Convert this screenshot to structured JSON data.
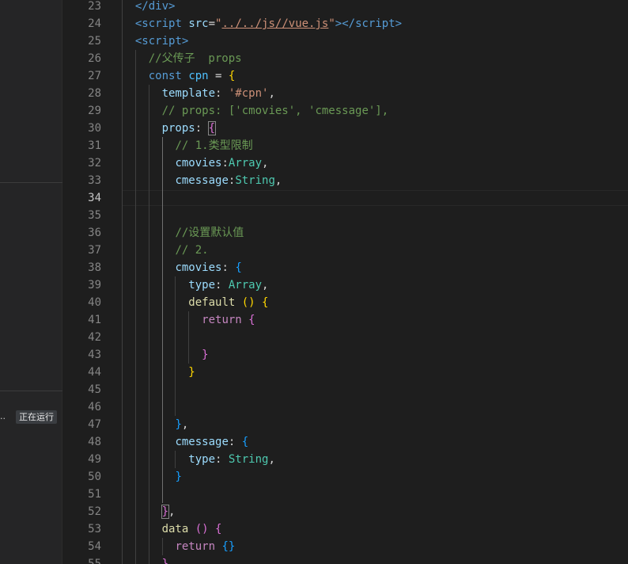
{
  "sidebar": {
    "ellipsis": "..",
    "status_badge": "正在运行"
  },
  "editor": {
    "active_line": 34,
    "lines": [
      {
        "n": 23,
        "tokens": [
          {
            "t": "</",
            "c": "tk-tag"
          },
          {
            "t": "div",
            "c": "tk-tag"
          },
          {
            "t": ">",
            "c": "tk-tag"
          }
        ],
        "indent": 1
      },
      {
        "n": 24,
        "tokens": [
          {
            "t": "<",
            "c": "tk-tag"
          },
          {
            "t": "script",
            "c": "tk-tag"
          },
          {
            "t": " ",
            "c": "tk-punc"
          },
          {
            "t": "src",
            "c": "tk-attr"
          },
          {
            "t": "=",
            "c": "tk-punc"
          },
          {
            "t": "\"",
            "c": "tk-str"
          },
          {
            "t": "../../js//vue.js",
            "c": "tk-str-u"
          },
          {
            "t": "\"",
            "c": "tk-str"
          },
          {
            "t": "></",
            "c": "tk-tag"
          },
          {
            "t": "script",
            "c": "tk-tag"
          },
          {
            "t": ">",
            "c": "tk-tag"
          }
        ],
        "indent": 1
      },
      {
        "n": 25,
        "tokens": [
          {
            "t": "<",
            "c": "tk-tag"
          },
          {
            "t": "script",
            "c": "tk-tag"
          },
          {
            "t": ">",
            "c": "tk-tag"
          }
        ],
        "indent": 1
      },
      {
        "n": 26,
        "tokens": [
          {
            "t": "//父传子  props",
            "c": "tk-cmt"
          }
        ],
        "indent": 2
      },
      {
        "n": 27,
        "tokens": [
          {
            "t": "const",
            "c": "tk-kw"
          },
          {
            "t": " ",
            "c": "tk-punc"
          },
          {
            "t": "cpn",
            "c": "tk-var"
          },
          {
            "t": " = ",
            "c": "tk-punc"
          },
          {
            "t": "{",
            "c": "br-gold"
          }
        ],
        "indent": 2
      },
      {
        "n": 28,
        "tokens": [
          {
            "t": "template",
            "c": "tk-prop"
          },
          {
            "t": ": ",
            "c": "tk-punc"
          },
          {
            "t": "'#cpn'",
            "c": "tk-str"
          },
          {
            "t": ",",
            "c": "tk-punc"
          }
        ],
        "indent": 3
      },
      {
        "n": 29,
        "tokens": [
          {
            "t": "// props: ['cmovies', 'cmessage'],",
            "c": "tk-cmt"
          }
        ],
        "indent": 3
      },
      {
        "n": 30,
        "tokens": [
          {
            "t": "props",
            "c": "tk-prop"
          },
          {
            "t": ": ",
            "c": "tk-punc"
          },
          {
            "t": "{",
            "c": "br-pink br-match"
          }
        ],
        "indent": 3
      },
      {
        "n": 31,
        "tokens": [
          {
            "t": "// 1.类型限制",
            "c": "tk-cmt"
          }
        ],
        "indent": 4
      },
      {
        "n": 32,
        "tokens": [
          {
            "t": "cmovies",
            "c": "tk-prop"
          },
          {
            "t": ":",
            "c": "tk-punc"
          },
          {
            "t": "Array",
            "c": "tk-type"
          },
          {
            "t": ",",
            "c": "tk-punc"
          }
        ],
        "indent": 4
      },
      {
        "n": 33,
        "tokens": [
          {
            "t": "cmessage",
            "c": "tk-prop"
          },
          {
            "t": ":",
            "c": "tk-punc"
          },
          {
            "t": "String",
            "c": "tk-type"
          },
          {
            "t": ",",
            "c": "tk-punc"
          }
        ],
        "indent": 4
      },
      {
        "n": 34,
        "tokens": [],
        "indent": 0
      },
      {
        "n": 35,
        "tokens": [],
        "indent": 0
      },
      {
        "n": 36,
        "tokens": [
          {
            "t": "//设置默认值",
            "c": "tk-cmt"
          }
        ],
        "indent": 4
      },
      {
        "n": 37,
        "tokens": [
          {
            "t": "// 2.",
            "c": "tk-cmt"
          }
        ],
        "indent": 4
      },
      {
        "n": 38,
        "tokens": [
          {
            "t": "cmovies",
            "c": "tk-prop"
          },
          {
            "t": ": ",
            "c": "tk-punc"
          },
          {
            "t": "{",
            "c": "br-blue"
          }
        ],
        "indent": 4
      },
      {
        "n": 39,
        "tokens": [
          {
            "t": "type",
            "c": "tk-prop"
          },
          {
            "t": ": ",
            "c": "tk-punc"
          },
          {
            "t": "Array",
            "c": "tk-type"
          },
          {
            "t": ",",
            "c": "tk-punc"
          }
        ],
        "indent": 5
      },
      {
        "n": 40,
        "tokens": [
          {
            "t": "default",
            "c": "tk-fn"
          },
          {
            "t": " ",
            "c": "tk-punc"
          },
          {
            "t": "()",
            "c": "br-gold"
          },
          {
            "t": " ",
            "c": "tk-punc"
          },
          {
            "t": "{",
            "c": "br-gold"
          }
        ],
        "indent": 5
      },
      {
        "n": 41,
        "tokens": [
          {
            "t": "return",
            "c": "tk-ctrl"
          },
          {
            "t": " ",
            "c": "tk-punc"
          },
          {
            "t": "{",
            "c": "br-pink"
          }
        ],
        "indent": 6
      },
      {
        "n": 42,
        "tokens": [],
        "indent": 0
      },
      {
        "n": 43,
        "tokens": [
          {
            "t": "}",
            "c": "br-pink"
          }
        ],
        "indent": 6
      },
      {
        "n": 44,
        "tokens": [
          {
            "t": "}",
            "c": "br-gold"
          }
        ],
        "indent": 5
      },
      {
        "n": 45,
        "tokens": [],
        "indent": 0
      },
      {
        "n": 46,
        "tokens": [],
        "indent": 0
      },
      {
        "n": 47,
        "tokens": [
          {
            "t": "}",
            "c": "br-blue"
          },
          {
            "t": ",",
            "c": "tk-punc"
          }
        ],
        "indent": 4
      },
      {
        "n": 48,
        "tokens": [
          {
            "t": "cmessage",
            "c": "tk-prop"
          },
          {
            "t": ": ",
            "c": "tk-punc"
          },
          {
            "t": "{",
            "c": "br-blue"
          }
        ],
        "indent": 4
      },
      {
        "n": 49,
        "tokens": [
          {
            "t": "type",
            "c": "tk-prop"
          },
          {
            "t": ": ",
            "c": "tk-punc"
          },
          {
            "t": "String",
            "c": "tk-type"
          },
          {
            "t": ",",
            "c": "tk-punc"
          }
        ],
        "indent": 5
      },
      {
        "n": 50,
        "tokens": [
          {
            "t": "}",
            "c": "br-blue"
          }
        ],
        "indent": 4
      },
      {
        "n": 51,
        "tokens": [],
        "indent": 0
      },
      {
        "n": 52,
        "tokens": [
          {
            "t": "}",
            "c": "br-pink br-match"
          },
          {
            "t": ",",
            "c": "tk-punc"
          }
        ],
        "indent": 3
      },
      {
        "n": 53,
        "tokens": [
          {
            "t": "data",
            "c": "tk-fn"
          },
          {
            "t": " ",
            "c": "tk-punc"
          },
          {
            "t": "()",
            "c": "br-pink"
          },
          {
            "t": " ",
            "c": "tk-punc"
          },
          {
            "t": "{",
            "c": "br-pink"
          }
        ],
        "indent": 3
      },
      {
        "n": 54,
        "tokens": [
          {
            "t": "return",
            "c": "tk-ctrl"
          },
          {
            "t": " ",
            "c": "tk-punc"
          },
          {
            "t": "{}",
            "c": "br-blue"
          }
        ],
        "indent": 4
      },
      {
        "n": 55,
        "tokens": [
          {
            "t": "}",
            "c": "br-pink"
          }
        ],
        "indent": 3
      }
    ]
  }
}
